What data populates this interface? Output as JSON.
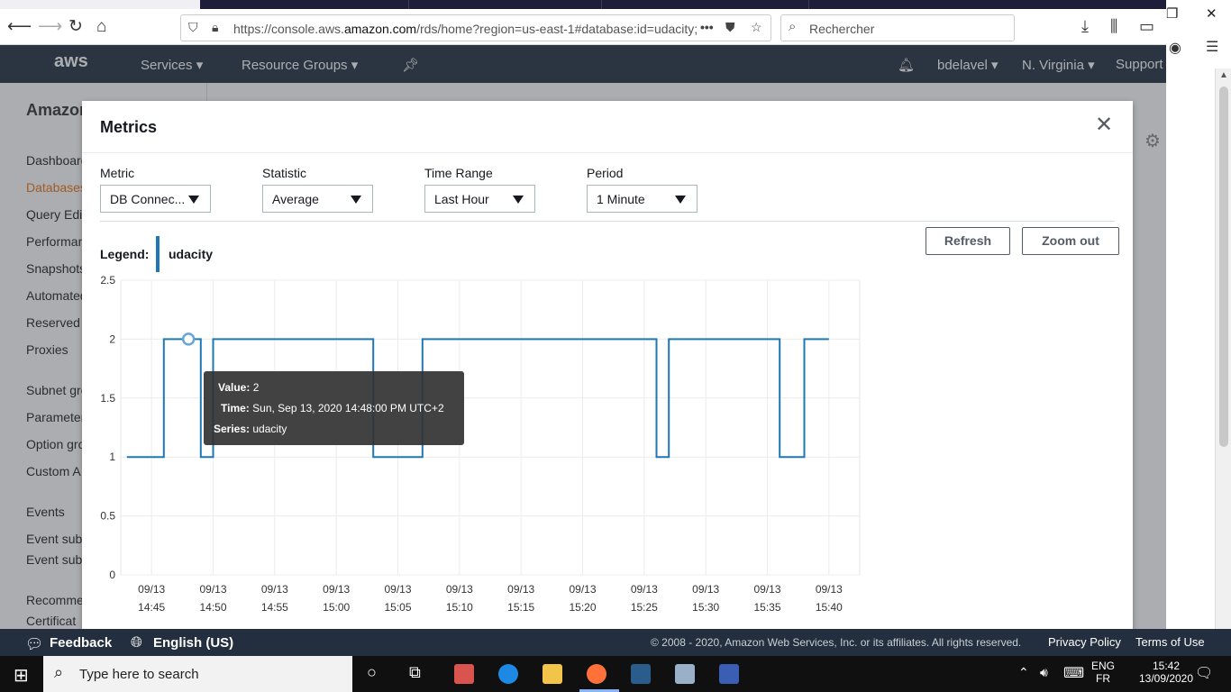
{
  "browser": {
    "url_prefix": "https://console.aws.",
    "url_domain": "amazon.com",
    "url_suffix": "/rds/home?region=us-east-1#database:id=udacity;",
    "search_placeholder": "Rechercher"
  },
  "aws_nav": {
    "logo": "aws",
    "services": "Services",
    "resource_groups": "Resource Groups",
    "user": "bdelavel",
    "region": "N. Virginia",
    "support": "Support"
  },
  "sidebar": {
    "brand": "Amazon",
    "items": [
      "Dashboard",
      "Databases",
      "Query Editor",
      "Performance",
      "Snapshots",
      "Automated",
      "Reserved",
      "Proxies",
      "Subnet groups",
      "Parameter",
      "Option groups",
      "Custom A",
      "Events",
      "Event sub",
      "Event sub",
      "Recommen",
      "Certificat"
    ]
  },
  "modal": {
    "title": "Metrics",
    "close": "✕",
    "controls": {
      "metric": {
        "label": "Metric",
        "value": "DB Connec..."
      },
      "statistic": {
        "label": "Statistic",
        "value": "Average"
      },
      "time_range": {
        "label": "Time Range",
        "value": "Last Hour"
      },
      "period": {
        "label": "Period",
        "value": "1 Minute"
      }
    },
    "refresh": "Refresh",
    "zoom_out": "Zoom out",
    "legend_label": "Legend:",
    "legend_series": "udacity"
  },
  "chart_data": {
    "type": "line",
    "step": true,
    "series": [
      {
        "name": "udacity",
        "color": "#1f77b4",
        "points": [
          [
            "14:43",
            1
          ],
          [
            "14:46",
            1
          ],
          [
            "14:46",
            2
          ],
          [
            "14:49",
            2
          ],
          [
            "14:49",
            1
          ],
          [
            "14:50",
            1
          ],
          [
            "14:50",
            2
          ],
          [
            "15:03",
            2
          ],
          [
            "15:03",
            1
          ],
          [
            "15:07",
            1
          ],
          [
            "15:07",
            2
          ],
          [
            "15:26",
            2
          ],
          [
            "15:26",
            1
          ],
          [
            "15:27",
            1
          ],
          [
            "15:27",
            2
          ],
          [
            "15:36",
            2
          ],
          [
            "15:36",
            1
          ],
          [
            "15:38",
            1
          ],
          [
            "15:38",
            2
          ],
          [
            "15:40",
            2
          ]
        ]
      }
    ],
    "x_ticks": [
      [
        "09/13",
        "14:45"
      ],
      [
        "09/13",
        "14:50"
      ],
      [
        "09/13",
        "14:55"
      ],
      [
        "09/13",
        "15:00"
      ],
      [
        "09/13",
        "15:05"
      ],
      [
        "09/13",
        "15:10"
      ],
      [
        "09/13",
        "15:15"
      ],
      [
        "09/13",
        "15:20"
      ],
      [
        "09/13",
        "15:25"
      ],
      [
        "09/13",
        "15:30"
      ],
      [
        "09/13",
        "15:35"
      ],
      [
        "09/13",
        "15:40"
      ]
    ],
    "y_ticks": [
      "0",
      "0.5",
      "1",
      "1.5",
      "2",
      "2.5"
    ],
    "ylim": [
      0,
      2.5
    ],
    "xlim": [
      "14:42:30",
      "15:42:30"
    ],
    "highlight": {
      "x": "14:48",
      "y": 2
    }
  },
  "tooltip": {
    "value_label": "Value:",
    "value": "2",
    "time_label": "Time:",
    "time": "Sun, Sep 13, 2020 14:48:00 PM UTC+2",
    "series_label": "Series:",
    "series": "udacity"
  },
  "footer": {
    "feedback": "Feedback",
    "language": "English (US)",
    "copyright": "© 2008 - 2020, Amazon Web Services, Inc. or its affiliates. All rights reserved.",
    "privacy": "Privacy Policy",
    "terms": "Terms of Use"
  },
  "taskbar": {
    "search_placeholder": "Type here to search",
    "lang1": "ENG",
    "lang2": "FR",
    "time": "15:42",
    "date": "13/09/2020"
  }
}
